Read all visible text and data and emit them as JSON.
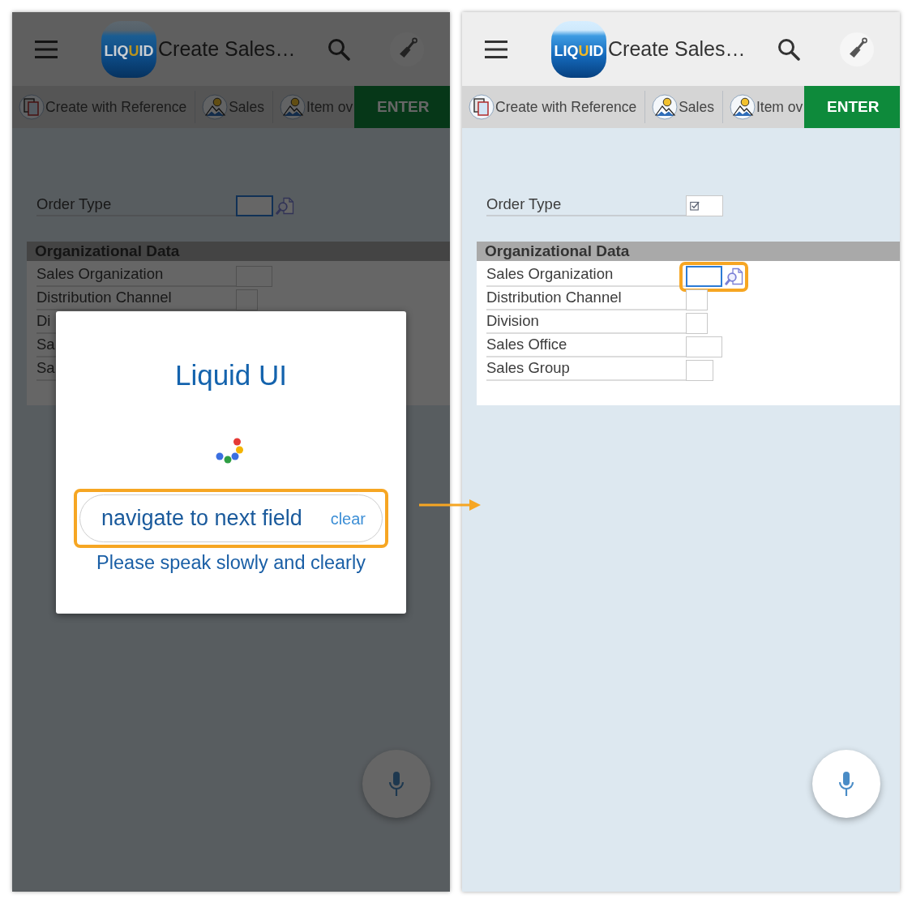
{
  "screens": [
    {
      "dimmed": true,
      "header": {
        "logo": [
          {
            "text": "LIQ",
            "color": "#c9cdd1"
          },
          {
            "text": "U",
            "color": "#b8921e"
          },
          {
            "text": "ID",
            "color": "#c9cdd1"
          }
        ],
        "title": "Create Sales…"
      },
      "toolbar": [
        {
          "kind": "pages",
          "label": "Create with Reference"
        },
        {
          "kind": "picture",
          "label": "Sales"
        },
        {
          "kind": "picture",
          "label": "Item ov"
        }
      ],
      "enter_button": "ENTER",
      "order_type": {
        "label": "Order Type",
        "field": {
          "focused": true,
          "checked": false,
          "highlighted": false
        }
      },
      "section": {
        "title": "Organizational Data",
        "rows": [
          {
            "label": "Sales Organization",
            "field": {
              "focused": false,
              "checked": false,
              "highlighted": false
            }
          },
          {
            "label": "Distribution Channel",
            "field": {
              "focused": false,
              "checked": false,
              "highlighted": false
            }
          },
          {
            "label": "Di"
          },
          {
            "label": "Sa"
          },
          {
            "label": "Sa"
          }
        ]
      },
      "dialog": {
        "title": "Liquid UI",
        "speech_field": {
          "value": "navigate to next field",
          "highlighted": true
        },
        "clear_button": "clear",
        "hint": "Please speak slowly and clearly"
      }
    },
    {
      "dimmed": false,
      "header": {
        "logo": [
          {
            "text": "LIQ",
            "color": "#ffffff"
          },
          {
            "text": "U",
            "color": "#f2b824"
          },
          {
            "text": "ID",
            "color": "#ffffff"
          }
        ],
        "title": "Create Sales…"
      },
      "toolbar": [
        {
          "kind": "pages",
          "label": "Create with Reference"
        },
        {
          "kind": "picture",
          "label": "Sales"
        },
        {
          "kind": "picture",
          "label": "Item ov"
        }
      ],
      "enter_button": "ENTER",
      "order_type": {
        "label": "Order Type",
        "field": {
          "focused": false,
          "checked": true,
          "highlighted": false
        }
      },
      "section": {
        "title": "Organizational Data",
        "rows": [
          {
            "label": "Sales Organization",
            "field": {
              "focused": true,
              "checked": false,
              "highlighted": true
            }
          },
          {
            "label": "Distribution Channel",
            "field": {
              "focused": false,
              "checked": false,
              "highlighted": false
            }
          },
          {
            "label": "Division",
            "field": {
              "focused": false,
              "checked": false,
              "highlighted": false
            }
          },
          {
            "label": "Sales Office",
            "field": {
              "focused": false,
              "checked": false,
              "highlighted": false
            }
          },
          {
            "label": "Sales Group",
            "field": {
              "focused": false,
              "checked": false,
              "highlighted": false
            }
          }
        ]
      }
    }
  ]
}
